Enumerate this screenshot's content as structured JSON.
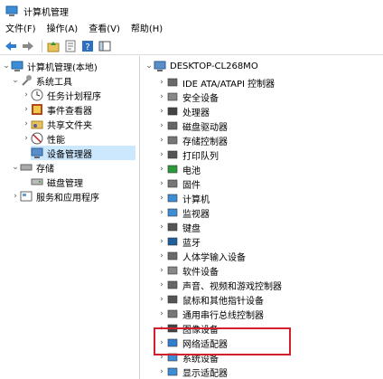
{
  "window": {
    "title": "计算机管理"
  },
  "menu": [
    "文件(F)",
    "操作(A)",
    "查看(V)",
    "帮助(H)"
  ],
  "toolbar": {
    "buttons": [
      "back-arrow-icon",
      "forward-arrow-icon",
      "up-folder-icon",
      "properties-icon",
      "help-icon",
      "show-pane-icon"
    ]
  },
  "left_tree": {
    "root": "计算机管理(本地)",
    "system_tools": "系统工具",
    "task_scheduler": "任务计划程序",
    "event_viewer": "事件查看器",
    "shared_folders": "共享文件夹",
    "performance": "性能",
    "device_manager": "设备管理器",
    "storage": "存储",
    "disk_management": "磁盘管理",
    "services_apps": "服务和应用程序"
  },
  "right_tree": {
    "computer": "DESKTOP-CL268MO",
    "categories": [
      "IDE ATA/ATAPI 控制器",
      "安全设备",
      "处理器",
      "磁盘驱动器",
      "存储控制器",
      "打印队列",
      "电池",
      "固件",
      "计算机",
      "监视器",
      "键盘",
      "蓝牙",
      "人体学输入设备",
      "软件设备",
      "声音、视频和游戏控制器",
      "鼠标和其他指针设备",
      "通用串行总线控制器",
      "图像设备",
      "网络适配器",
      "系统设备",
      "显示适配器"
    ]
  },
  "colors": {
    "selection": "#cce8ff",
    "highlight": "#d21f2b",
    "accent": "#1e73c8"
  }
}
